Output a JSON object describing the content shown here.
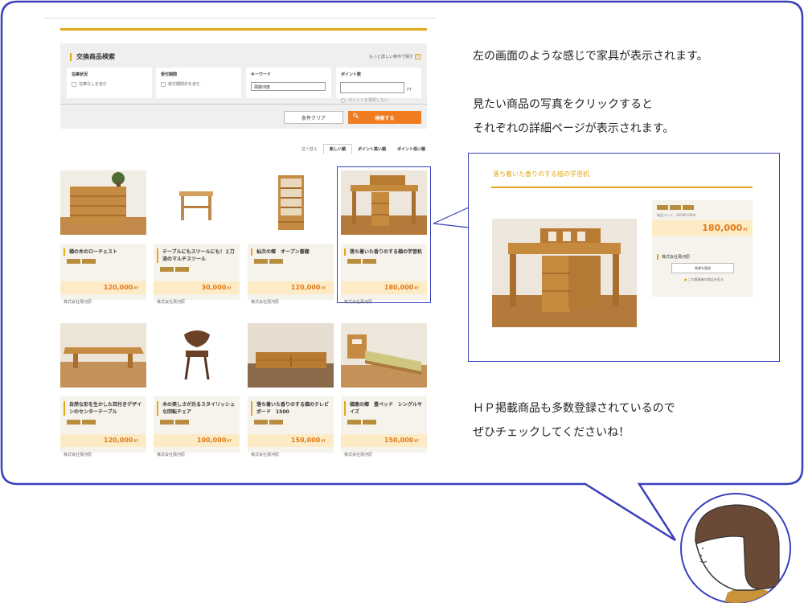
{
  "search": {
    "title": "交換商品検索",
    "more_conditions": "もっと詳しい条件で探す",
    "stock": {
      "title": "在庫状況",
      "checkbox_label": "在庫なしを含む"
    },
    "reception": {
      "title": "受付期間",
      "checkbox_label": "受付期間外を含む"
    },
    "keyword": {
      "title": "キーワード",
      "value": "飛騨河度"
    },
    "points": {
      "title": "ポイント数",
      "unit": "PT",
      "radio_label": "ポイントを選択しない"
    },
    "clear_label": "条件クリア",
    "search_label": "検索する",
    "search_icon": "search-icon"
  },
  "sort": {
    "label": "並べ替え",
    "tabs": [
      "新しい順",
      "ポイント高い順",
      "ポイント低い順"
    ],
    "active": 0
  },
  "products": [
    {
      "name": "楢の木のローチェスト",
      "price": "120,000",
      "vendor": "株式会社飛河原"
    },
    {
      "name": "テーブルにもスツールにも！２刀流のマルチスツール",
      "price": "30,000",
      "vendor": "株式会社飛河原"
    },
    {
      "name": "杣次の郷　オープン書棚",
      "price": "120,000",
      "vendor": "株式会社飛河原"
    },
    {
      "name": "落ち着いた香りのする楢の学習机",
      "price": "180,000",
      "vendor": "株式会社飛河原"
    },
    {
      "name": "自然な形を生かした耳付きデザインのセンターテーブル",
      "price": "120,000",
      "vendor": "株式会社飛河原"
    },
    {
      "name": "木の美しさが光るスタイリッシュな回転チェア",
      "price": "100,000",
      "vendor": "株式会社飛河原"
    },
    {
      "name": "落ち着いた香りのする楢のテレビボード　1500",
      "price": "150,000",
      "vendor": "株式会社飛河原"
    },
    {
      "name": "楢恵の郷　畳ベッド　シングルサイズ",
      "price": "150,000",
      "vendor": "株式会社飛河原"
    }
  ],
  "price_unit": "PT",
  "detail": {
    "title": "落ち着いた香りのする楢の学習机",
    "code": "商品コード：20006-0004",
    "price": "180,000",
    "vendor": "株式会社飛河原",
    "button_label": "希望を登録",
    "link_label": "この事業者の商品を見る"
  },
  "explanation": {
    "line1": "左の画面のような感じで家具が表示されます。",
    "line2": "見たい商品の写真をクリックすると",
    "line3": "それぞれの詳細ページが表示されます。",
    "line4": "ＨＰ掲載商品も多数登録されているので",
    "line5": "ぜひチェックしてくださいね！"
  },
  "colors": {
    "accent": "#e2a81a",
    "search_button": "#f07c22",
    "price": "#e07b1e",
    "bubble_border": "#3a3fbd"
  }
}
